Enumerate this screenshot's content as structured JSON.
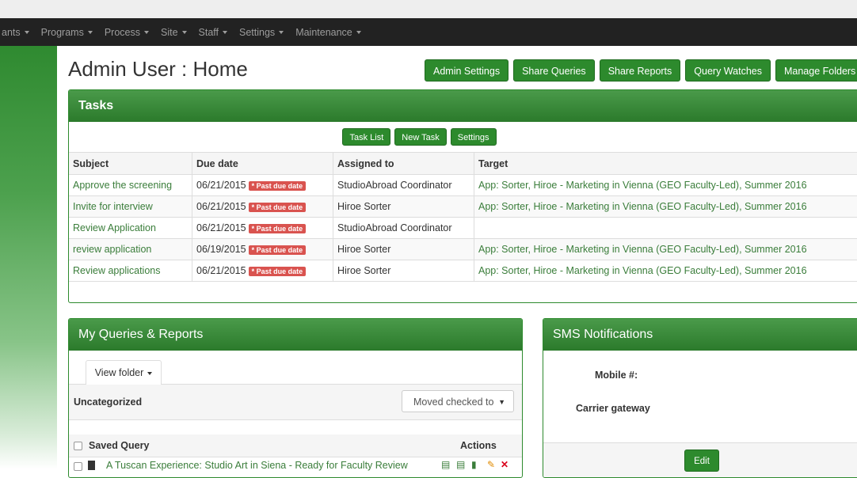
{
  "nav": {
    "items": [
      {
        "label": "ants"
      },
      {
        "label": "Programs"
      },
      {
        "label": "Process"
      },
      {
        "label": "Site"
      },
      {
        "label": "Staff"
      },
      {
        "label": "Settings"
      },
      {
        "label": "Maintenance"
      }
    ]
  },
  "page": {
    "title": "Admin User : Home"
  },
  "top_buttons": {
    "admin_settings": "Admin Settings",
    "share_queries": "Share Queries",
    "share_reports": "Share Reports",
    "query_watches": "Query Watches",
    "manage_folders": "Manage Folders"
  },
  "tasks": {
    "heading": "Tasks",
    "toolbar": {
      "task_list": "Task List",
      "new_task": "New Task",
      "settings": "Settings"
    },
    "columns": {
      "subject": "Subject",
      "due_date": "Due date",
      "assigned_to": "Assigned to",
      "target": "Target"
    },
    "rows": [
      {
        "subject": "Approve the screening",
        "due": "06/21/2015",
        "badge": "* Past due date",
        "assigned": "StudioAbroad Coordinator",
        "target": "App: Sorter, Hiroe - Marketing in Vienna (GEO Faculty-Led), Summer 2016"
      },
      {
        "subject": "Invite for interview",
        "due": "06/21/2015",
        "badge": "* Past due date",
        "assigned": "Hiroe Sorter",
        "target": "App: Sorter, Hiroe - Marketing in Vienna (GEO Faculty-Led), Summer 2016"
      },
      {
        "subject": "Review Application",
        "due": "06/21/2015",
        "badge": "* Past due date",
        "assigned": "StudioAbroad Coordinator",
        "target": ""
      },
      {
        "subject": "review application",
        "due": "06/19/2015",
        "badge": "* Past due date",
        "assigned": "Hiroe Sorter",
        "target": "App: Sorter, Hiroe - Marketing in Vienna (GEO Faculty-Led), Summer 2016"
      },
      {
        "subject": "Review applications",
        "due": "06/21/2015",
        "badge": "* Past due date",
        "assigned": "Hiroe Sorter",
        "target": "App: Sorter, Hiroe - Marketing in Vienna (GEO Faculty-Led), Summer 2016"
      }
    ]
  },
  "queries": {
    "heading": "My Queries & Reports",
    "view_folder": "View folder",
    "folder": "Uncategorized",
    "move_select": "Moved checked to",
    "col_saved_query": "Saved Query",
    "col_actions": "Actions",
    "items": [
      {
        "label": "A Tuscan Experience: Studio Art in Siena - Ready for Faculty Review"
      }
    ]
  },
  "sms": {
    "heading": "SMS Notifications",
    "mobile_label": "Mobile #:",
    "carrier_label": "Carrier gateway",
    "edit": "Edit"
  },
  "colors": {
    "brand_green": "#2d8a2d",
    "navbar": "#222222",
    "past_due_badge": "#d9534f",
    "link_green": "#3a7d3a"
  }
}
